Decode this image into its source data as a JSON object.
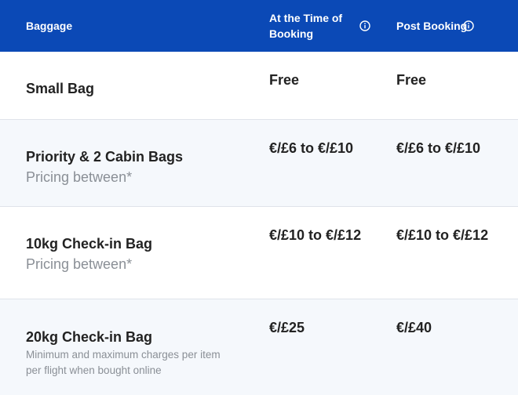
{
  "header": {
    "baggage": "Baggage",
    "time_of_booking": "At the Time of Booking",
    "post_booking": "Post Booking"
  },
  "rows": [
    {
      "name": "Small Bag",
      "time_price": "Free",
      "post_price": "Free"
    },
    {
      "name": "Priority & 2 Cabin Bags",
      "subtitle": "Pricing between*",
      "time_price": "€/£6 to €/£10",
      "post_price": "€/£6 to €/£10"
    },
    {
      "name": "10kg Check-in Bag",
      "subtitle": "Pricing between*",
      "time_price": "€/£10 to €/£12",
      "post_price": "€/£10 to €/£12"
    },
    {
      "name": "20kg Check-in Bag",
      "note": "Minimum and maximum charges per item per flight when bought online",
      "time_price": "€/£25",
      "post_price": "€/£40"
    }
  ],
  "icons": {
    "info": "info-circle-icon"
  },
  "colors": {
    "header_bg": "#0b49b6",
    "header_text": "#ffffff",
    "alt_row_bg": "#f5f8fc",
    "muted_text": "#8a8f96"
  }
}
